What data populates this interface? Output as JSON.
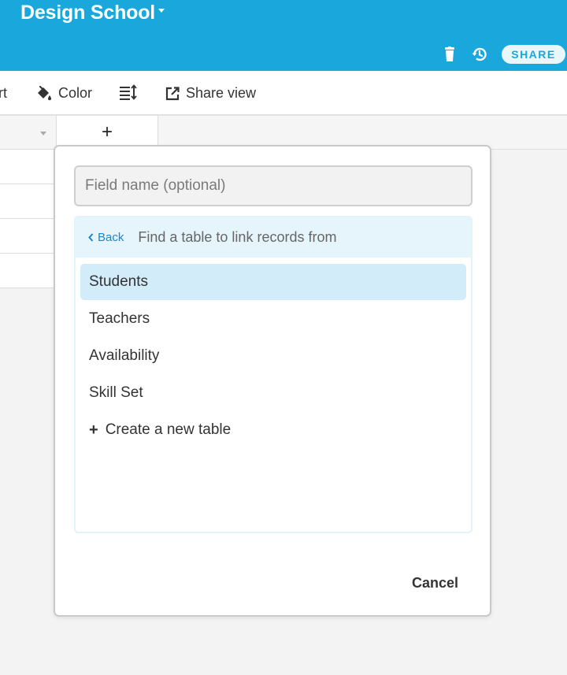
{
  "header": {
    "base_title": "Design School",
    "share_label": "SHARE",
    "colors": {
      "bar": "#1aa7db",
      "text": "#ffffff"
    }
  },
  "toolbar": {
    "sort_label": "rt",
    "color_label": "Color",
    "share_view_label": "Share view"
  },
  "grid": {
    "add_column_label": "+"
  },
  "dialog": {
    "field_name_value": "",
    "field_name_placeholder": "Field name (optional)",
    "back_label": "Back",
    "prompt": "Find a table to link records from",
    "tables": [
      {
        "label": "Students",
        "selected": true
      },
      {
        "label": "Teachers",
        "selected": false
      },
      {
        "label": "Availability",
        "selected": false
      },
      {
        "label": "Skill Set",
        "selected": false
      }
    ],
    "create_label": "Create a new table",
    "cancel_label": "Cancel",
    "accent": "#1d86d0",
    "selected_bg": "#d2ecf9"
  }
}
